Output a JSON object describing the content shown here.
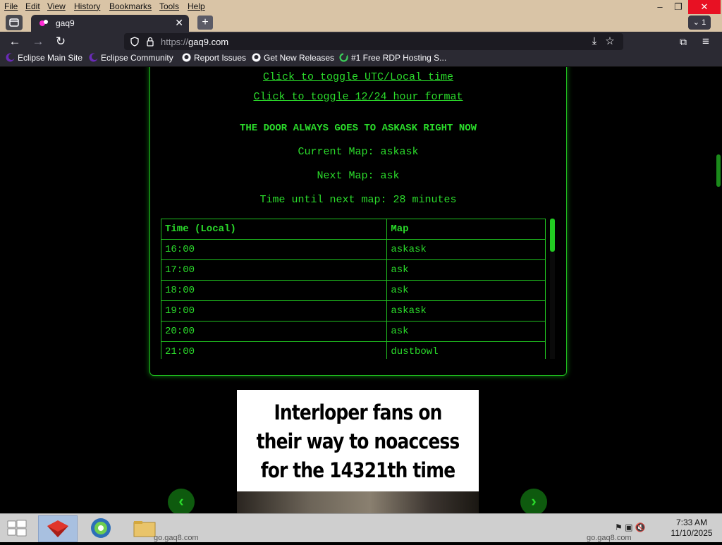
{
  "menubar": {
    "items": [
      "File",
      "Edit",
      "View",
      "History",
      "Bookmarks",
      "Tools",
      "Help"
    ]
  },
  "window": {
    "minimize": "–",
    "restore": "❐",
    "close": "✕"
  },
  "tabs": {
    "active": {
      "title": "gaq9",
      "close": "✕"
    },
    "new_tab": "+",
    "all_tabs_count": "1"
  },
  "navbar": {
    "back": "←",
    "forward": "→",
    "reload": "↻",
    "url_protocol": "https://",
    "url_host": "gaq9.com"
  },
  "bookmarks": [
    {
      "label": "Eclipse Main Site",
      "icon": "eclipse-icon"
    },
    {
      "label": "Eclipse Community",
      "icon": "eclipse-icon"
    },
    {
      "label": "Report Issues",
      "icon": "github-icon"
    },
    {
      "label": "Get New Releases",
      "icon": "github-icon"
    },
    {
      "label": "#1 Free RDP Hosting S...",
      "icon": "refresh-green-icon"
    }
  ],
  "page": {
    "toggle_utc": "Click to toggle UTC/Local time",
    "toggle_hour": "Click to toggle 12/24 hour format",
    "door_status": "THE DOOR ALWAYS GOES TO ASKASK RIGHT NOW",
    "current_map": "Current Map: askask",
    "next_map": "Next Map: ask",
    "time_until": "Time until next map: 28 minutes",
    "table": {
      "headers": [
        "Time (Local)",
        "Map"
      ],
      "rows": [
        [
          "16:00",
          "askask"
        ],
        [
          "17:00",
          "ask"
        ],
        [
          "18:00",
          "ask"
        ],
        [
          "19:00",
          "askask"
        ],
        [
          "20:00",
          "ask"
        ],
        [
          "21:00",
          "dustbowl"
        ]
      ]
    },
    "meme_caption": [
      "Interloper fans on",
      "their way to noaccess",
      "for the 14321th time"
    ],
    "carousel_prev": "‹",
    "carousel_next": "›"
  },
  "taskbar": {
    "under_left": "go.gaq8.com",
    "under_right": "go.gaq8.com",
    "time": "7:33 AM",
    "date": "11/10/2025"
  },
  "colors": {
    "terminal_green": "#2bdc2b",
    "menubar_bg": "#d9c4a6",
    "browser_dark": "#2b2a33"
  }
}
